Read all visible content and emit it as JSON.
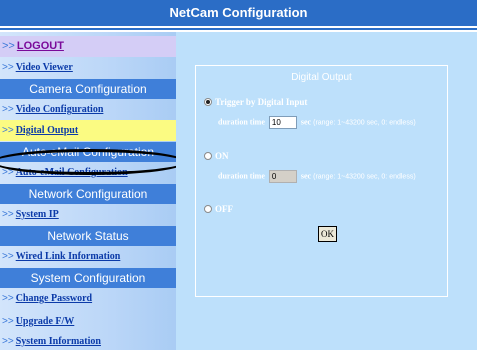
{
  "header": {
    "title": "NetCam Configuration"
  },
  "sidebar": {
    "arrow": ">>",
    "logout": "LOGOUT",
    "video_viewer": "Video Viewer",
    "sections": {
      "camera": "Camera Configuration",
      "email": "Auto-eMail Configuration",
      "network": "Network Configuration",
      "status": "Network Status",
      "system": "System Configuration"
    },
    "items": {
      "video_configuration": "Video Configuration",
      "digital_output": "Digital Output",
      "auto_email_configuration": "Auto-eMail Configuration",
      "system_ip": "System IP",
      "wired_link_information": "Wired Link Information",
      "change_password": "Change Password",
      "upgrade_fw": "Upgrade F/W",
      "system_information": "System Information"
    },
    "selected": "Digital Output"
  },
  "form": {
    "title": "Digital Output",
    "options": {
      "trigger": "Trigger by Digital Input",
      "on": "ON",
      "off": "OFF"
    },
    "selected_option": "trigger",
    "duration_label": "duration time",
    "duration_value": "10",
    "duration_placeholder_disabled": "0",
    "unit": "sec",
    "range_text": "(range: 1~43200 sec, 0: endless)",
    "ok_label": "OK"
  },
  "colors": {
    "title_bar": "#2b6dc6",
    "section_header": "#3f7fd9",
    "highlight": "#fbfb82",
    "main_bg": "#bde0fb"
  }
}
